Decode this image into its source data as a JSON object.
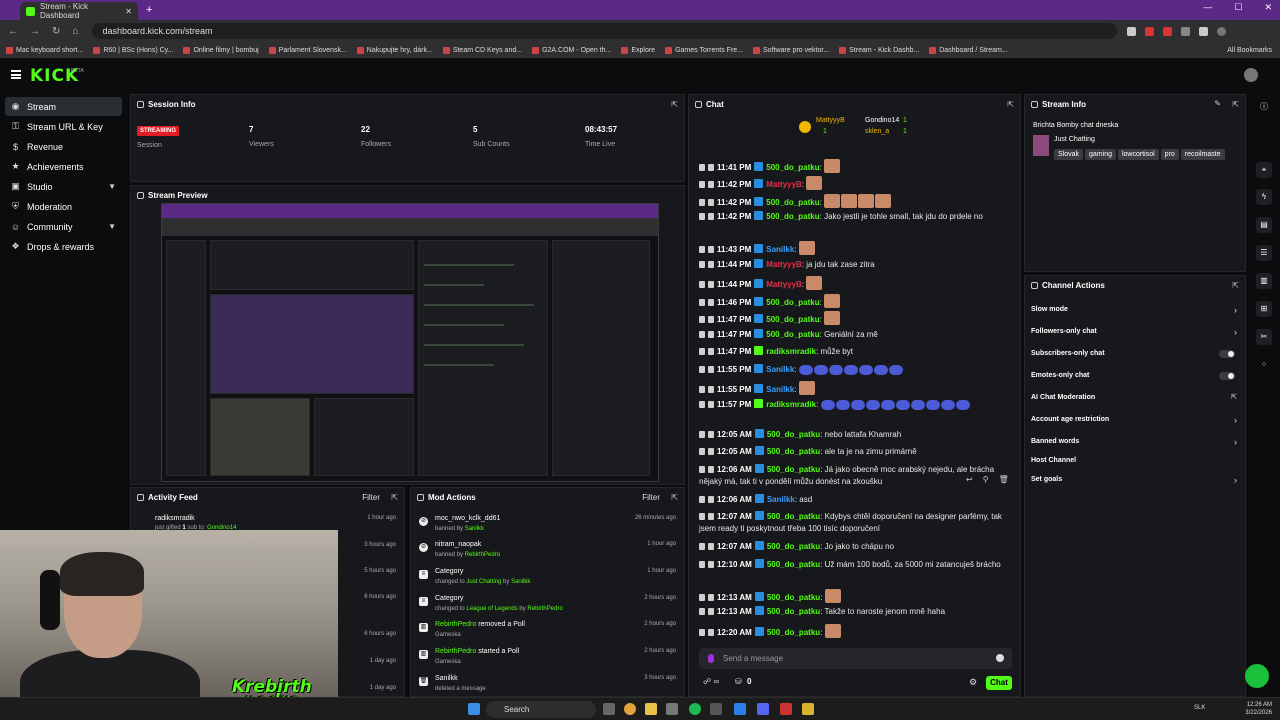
{
  "browser": {
    "tab_title": "Stream - Kick Dashboard",
    "url": "dashboard.kick.com/stream",
    "bookmarks": [
      "Mac keyboard short...",
      "R60 | BSc (Hons) Cy...",
      "Online filmy | bombuj",
      "Parlament Slovensk...",
      "Nakupujte hry, dárk...",
      "Steam CD Keys and...",
      "G2A.COM - Open th...",
      "Explore",
      "Games Torrents Fre...",
      "Software pro vektor...",
      "Stream - Kick Dashb...",
      "Dashboard / Stream..."
    ],
    "all_bookmarks": "All Bookmarks"
  },
  "header": {
    "logo": "KICK",
    "beta": "BETA"
  },
  "sidebar": {
    "items": [
      {
        "label": "Stream",
        "icon": "broadcast-icon"
      },
      {
        "label": "Stream URL & Key",
        "icon": "key-icon"
      },
      {
        "label": "Revenue",
        "icon": "dollar-icon"
      },
      {
        "label": "Achievements",
        "icon": "trophy-icon"
      },
      {
        "label": "Studio",
        "icon": "studio-icon"
      },
      {
        "label": "Moderation",
        "icon": "shield-icon"
      },
      {
        "label": "Community",
        "icon": "community-icon"
      },
      {
        "label": "Drops & rewards",
        "icon": "gift-icon"
      }
    ]
  },
  "session": {
    "title": "Session Info",
    "status": "STREAMING",
    "session_label": "Session",
    "viewers": "7",
    "viewers_label": "Viewers",
    "followers": "22",
    "followers_label": "Followers",
    "subs": "5",
    "subs_label": "Sub Counts",
    "time": "08:43:57",
    "time_label": "Time Live"
  },
  "preview": {
    "title": "Stream Preview"
  },
  "activity": {
    "title": "Activity Feed",
    "filter": "Filter",
    "rows": [
      {
        "name": "radiksmradik",
        "desc_prefix": "just gifted ",
        "count": "1",
        "desc_mid": " sub to: ",
        "target": "Gondino14",
        "time": "1 hour ago"
      },
      {
        "time": "3 hours ago"
      },
      {
        "time": "5 hours ago"
      },
      {
        "time": "6 hours ago"
      },
      {
        "time": "6 hours ago"
      },
      {
        "time": "1 day ago"
      },
      {
        "time": "1 day ago"
      }
    ]
  },
  "mod": {
    "title": "Mod Actions",
    "filter": "Filter",
    "rows": [
      {
        "title": "moc_nwo_kclk_dd61",
        "sub": "banned by ",
        "by": "Sanilkk",
        "time": "26 minutes ago"
      },
      {
        "title": "nitram_naopak",
        "sub": "banned by ",
        "by": "RebirthPedro",
        "time": "1 hour ago"
      },
      {
        "title": "Category",
        "sub": "changed to ",
        "target": "Just Chatting",
        "by_prefix": " by ",
        "by": "Sanilkk",
        "time": "1 hour ago"
      },
      {
        "title": "Category",
        "sub": "changed to ",
        "target": "League of Legends",
        "by_prefix": " by ",
        "by": "RebirthPedro",
        "time": "2 hours ago"
      },
      {
        "title_user": "RebirthPedro",
        "title": " removed a Poll",
        "sub": "Gameska",
        "time": "2 hours ago"
      },
      {
        "title_user": "RebirthPedro",
        "title": " started a Poll",
        "sub": "Gameska",
        "time": "2 hours ago"
      },
      {
        "title": "Sanilkk",
        "sub": "deleted a message",
        "time": "3 hours ago"
      }
    ]
  },
  "chat": {
    "title": "Chat",
    "top_users": [
      {
        "name": "MattyyyB",
        "count": "1"
      },
      {
        "name": "Gondino14",
        "count": "1"
      },
      {
        "name": "sklen_a",
        "count": "1"
      }
    ],
    "messages": [
      {
        "time": "11:41 PM",
        "user": "500_do_patku",
        "color": "#53fc18",
        "text": "",
        "emotes": 1
      },
      {
        "time": "11:42 PM",
        "user": "MattyyyB",
        "color": "#e0304a",
        "text": "",
        "emotes": 1
      },
      {
        "time": "11:42 PM",
        "user": "500_do_patku",
        "color": "#53fc18",
        "text": "",
        "emotes": 4
      },
      {
        "time": "11:42 PM",
        "user": "500_do_patku",
        "color": "#53fc18",
        "text": "Jako jestli je tohle small, tak jdu do prdele no",
        "emotes": 0
      },
      {
        "time": "11:43 PM",
        "user": "Sanilkk",
        "color": "#3aa0ff",
        "text": "",
        "emotes": 1
      },
      {
        "time": "11:44 PM",
        "user": "MattyyyB",
        "color": "#e0304a",
        "text": "ja jdu tak zase zitra",
        "emotes": 0
      },
      {
        "time": "11:44 PM",
        "user": "MattyyyB",
        "color": "#e0304a",
        "text": "",
        "emotes": 1
      },
      {
        "time": "11:46 PM",
        "user": "500_do_patku",
        "color": "#53fc18",
        "text": "",
        "emotes": 1
      },
      {
        "time": "11:47 PM",
        "user": "500_do_patku",
        "color": "#53fc18",
        "text": "",
        "emotes": 1
      },
      {
        "time": "11:47 PM",
        "user": "500_do_patku",
        "color": "#53fc18",
        "text": "Geniální za mě",
        "emotes": 0
      },
      {
        "time": "11:47 PM",
        "user": "radiksmradik",
        "color": "#53fc18",
        "text": "může byt",
        "emotes": 0
      },
      {
        "time": "11:55 PM",
        "user": "Sanilkk",
        "color": "#3aa0ff",
        "text": "",
        "emotes": 7
      },
      {
        "time": "11:55 PM",
        "user": "Sanilkk",
        "color": "#3aa0ff",
        "text": "",
        "emotes": 1
      },
      {
        "time": "11:57 PM",
        "user": "radiksmradik",
        "color": "#53fc18",
        "text": "",
        "emotes": 10
      },
      {
        "time": "12:05 AM",
        "user": "500_do_patku",
        "color": "#53fc18",
        "text": "nebo lattafa Khamrah",
        "emotes": 0
      },
      {
        "time": "12:05 AM",
        "user": "500_do_patku",
        "color": "#53fc18",
        "text": "ale ta je na zimu primárně",
        "emotes": 0
      },
      {
        "time": "12:06 AM",
        "user": "500_do_patku",
        "color": "#53fc18",
        "text": "Já jako obecně moc arabský nejedu, ale brácha nějaký má, tak ti v pondělí můžu donést na zkoušku",
        "emotes": 0
      },
      {
        "time": "12:06 AM",
        "user": "Sanilkk",
        "color": "#3aa0ff",
        "text": "asd",
        "emotes": 0
      },
      {
        "time": "12:07 AM",
        "user": "500_do_patku",
        "color": "#53fc18",
        "text": "Kdybys chtěl doporučení na designer parfémy, tak jsem ready ti poskytnout třeba 100 tisíc doporučení",
        "emotes": 0
      },
      {
        "time": "12:07 AM",
        "user": "500_do_patku",
        "color": "#53fc18",
        "text": "Jo jako to chápu no",
        "emotes": 0
      },
      {
        "time": "12:10 AM",
        "user": "500_do_patku",
        "color": "#53fc18",
        "text": "Už mám 100 bodů, za 5000 mi zatancuješ brácho",
        "emotes": 0
      },
      {
        "time": "12:13 AM",
        "user": "500_do_patku",
        "color": "#53fc18",
        "text": "",
        "emotes": 1
      },
      {
        "time": "12:13 AM",
        "user": "500_do_patku",
        "color": "#53fc18",
        "text": "Takže to naroste jenom mně haha",
        "emotes": 0
      },
      {
        "time": "12:20 AM",
        "user": "500_do_patku",
        "color": "#53fc18",
        "text": "",
        "emotes": 1
      }
    ],
    "input_placeholder": "Send a message",
    "points": "0",
    "send_label": "Chat"
  },
  "stream_info": {
    "title": "Stream Info",
    "stream_title": "Brichta Bomby chat dneska",
    "category": "Just Chatting",
    "tags": [
      "Slovak",
      "gaming",
      "lowcortisol",
      "pro",
      "recoilmaste"
    ]
  },
  "channel_actions": {
    "title": "Channel Actions",
    "items": [
      {
        "label": "Slow mode",
        "control": "chevron"
      },
      {
        "label": "Followers-only chat",
        "control": "chevron"
      },
      {
        "label": "Subscribers-only chat",
        "control": "toggle"
      },
      {
        "label": "Emotes-only chat",
        "control": "toggle"
      },
      {
        "label": "AI Chat Moderation",
        "control": "external"
      },
      {
        "label": "Account age restriction",
        "control": "chevron"
      },
      {
        "label": "Banned words",
        "control": "chevron"
      },
      {
        "label": "Host Channel",
        "control": "none"
      },
      {
        "label": "Set goals",
        "control": "chevron"
      }
    ]
  },
  "webcam": {
    "watermark_top": "Krebirth",
    "watermark_bottom": "pedro"
  },
  "taskbar": {
    "search": "Search",
    "lang": "SLK",
    "time": "12:26 AM",
    "date": "3/22/2026"
  },
  "colors": {
    "accent": "#53fc18",
    "live": "#e31b23",
    "browser": "#5b2a86"
  }
}
